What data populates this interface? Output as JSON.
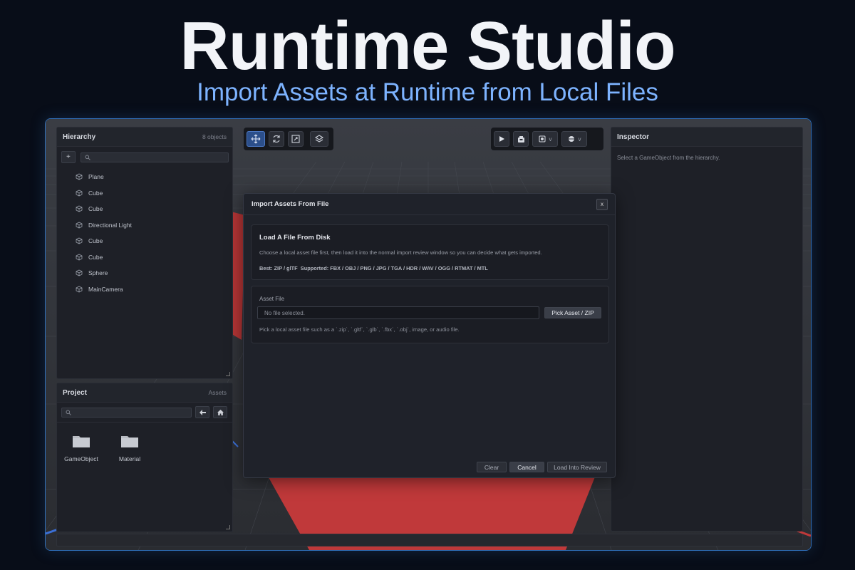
{
  "banner": {
    "title": "Runtime Studio",
    "subtitle": "Import Assets at Runtime from Local Files"
  },
  "colors": {
    "accent": "#2f6fba",
    "subtitle": "#7db3ff",
    "plane_red": "#c0393a",
    "panel_bg": "#1e2027"
  },
  "hierarchy": {
    "title": "Hierarchy",
    "count": "8 objects",
    "add_label": "+",
    "search_placeholder": "",
    "items": [
      {
        "label": "Plane",
        "icon": "cube-icon"
      },
      {
        "label": "Cube",
        "icon": "cube-icon"
      },
      {
        "label": "Cube",
        "icon": "cube-icon"
      },
      {
        "label": "Directional Light",
        "icon": "cube-icon"
      },
      {
        "label": "Cube",
        "icon": "cube-icon"
      },
      {
        "label": "Cube",
        "icon": "cube-icon"
      },
      {
        "label": "Sphere",
        "icon": "cube-icon"
      },
      {
        "label": "MainCamera",
        "icon": "cube-icon"
      }
    ]
  },
  "project": {
    "title": "Project",
    "path": "Assets",
    "folders": [
      {
        "label": "GameObject",
        "icon": "folder-icon"
      },
      {
        "label": "Material",
        "icon": "folder-icon"
      }
    ]
  },
  "toolbar_left": {
    "icons": [
      "move-icon",
      "rotate-icon",
      "scale-icon",
      "layers-icon"
    ]
  },
  "toolbar_right": {
    "icons": [
      "play-icon",
      "save-icon",
      "camera-icon",
      "sphere-icon"
    ],
    "dropdown_label": "v"
  },
  "inspector": {
    "title": "Inspector",
    "hint": "Select a GameObject from the hierarchy."
  },
  "dialog": {
    "title": "Import Assets From File",
    "close_label": "x",
    "section1": {
      "heading": "Load A File From Disk",
      "description": "Choose a local asset file first, then load it into the normal import review window so you can decide what gets imported.",
      "formats": "Best: ZIP / glTF  Supported: FBX / OBJ / PNG / JPG / TGA / HDR / WAV / OGG / RTMAT / MTL"
    },
    "section2": {
      "label": "Asset File",
      "file_value": "No file selected.",
      "pick_label": "Pick Asset / ZIP",
      "help": "Pick a local asset file such as a `.zip`, `.gltf`, `.glb`, `.fbx`, `.obj`, image, or audio file."
    },
    "buttons": {
      "clear": "Clear",
      "cancel": "Cancel",
      "load": "Load Into Review"
    }
  }
}
